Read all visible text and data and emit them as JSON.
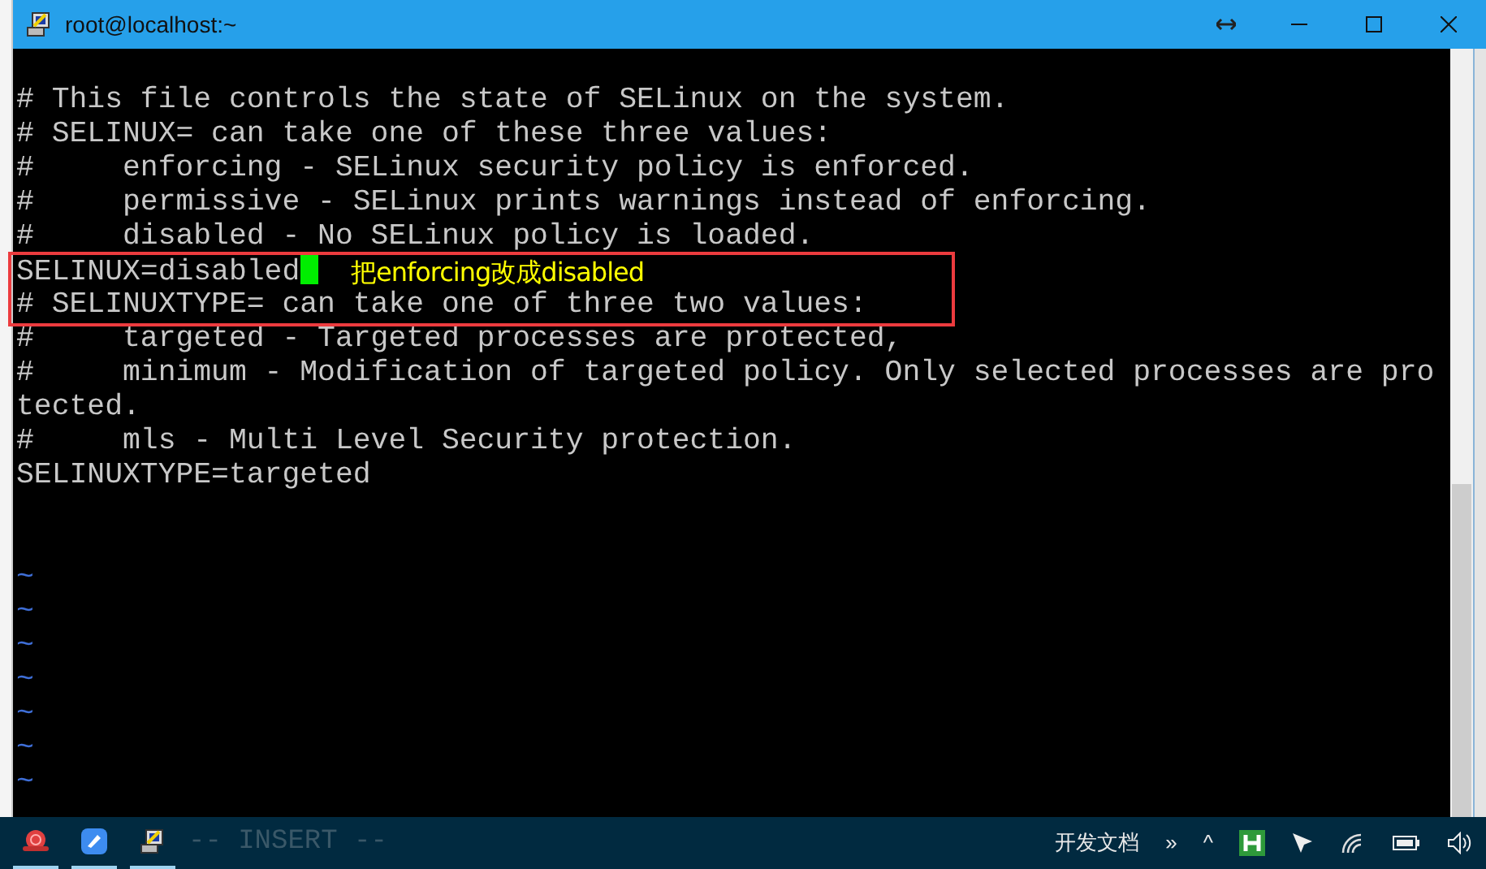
{
  "window": {
    "title": "root@localhost:~"
  },
  "terminal": {
    "lines": [
      {
        "kind": "text",
        "text": "# This file controls the state of SELinux on the system.",
        "cursor": false
      },
      {
        "kind": "text",
        "text": "# SELINUX= can take one of these three values:",
        "cursor": false
      },
      {
        "kind": "text",
        "text": "#     enforcing - SELinux security policy is enforced.",
        "cursor": false
      },
      {
        "kind": "text",
        "text": "#     permissive - SELinux prints warnings instead of enforcing.",
        "cursor": false
      },
      {
        "kind": "text",
        "text": "#     disabled - No SELinux policy is loaded.",
        "cursor": false
      },
      {
        "kind": "text",
        "text": "SELINUX=disabled",
        "cursor": true
      },
      {
        "kind": "text",
        "text": "# SELINUXTYPE= can take one of three two values:",
        "cursor": false
      },
      {
        "kind": "text",
        "text": "#     targeted - Targeted processes are protected,",
        "cursor": false
      },
      {
        "kind": "text",
        "text": "#     minimum - Modification of targeted policy. Only selected processes are pro",
        "cursor": false
      },
      {
        "kind": "text",
        "text": "tected.",
        "cursor": false
      },
      {
        "kind": "text",
        "text": "#     mls - Multi Level Security protection.",
        "cursor": false
      },
      {
        "kind": "text",
        "text": "SELINUXTYPE=targeted",
        "cursor": false
      },
      {
        "kind": "blank"
      },
      {
        "kind": "blank"
      },
      {
        "kind": "tilde",
        "text": "~"
      },
      {
        "kind": "tilde",
        "text": "~"
      },
      {
        "kind": "tilde",
        "text": "~"
      },
      {
        "kind": "tilde",
        "text": "~"
      },
      {
        "kind": "tilde",
        "text": "~"
      },
      {
        "kind": "tilde",
        "text": "~"
      },
      {
        "kind": "tilde",
        "text": "~"
      }
    ],
    "annotation": {
      "text": "把enforcing改成disabled"
    },
    "status_line": "-- INSERT --"
  },
  "taskbar": {
    "tray_label": "开发文档",
    "overflow": "»",
    "expand": "^"
  }
}
